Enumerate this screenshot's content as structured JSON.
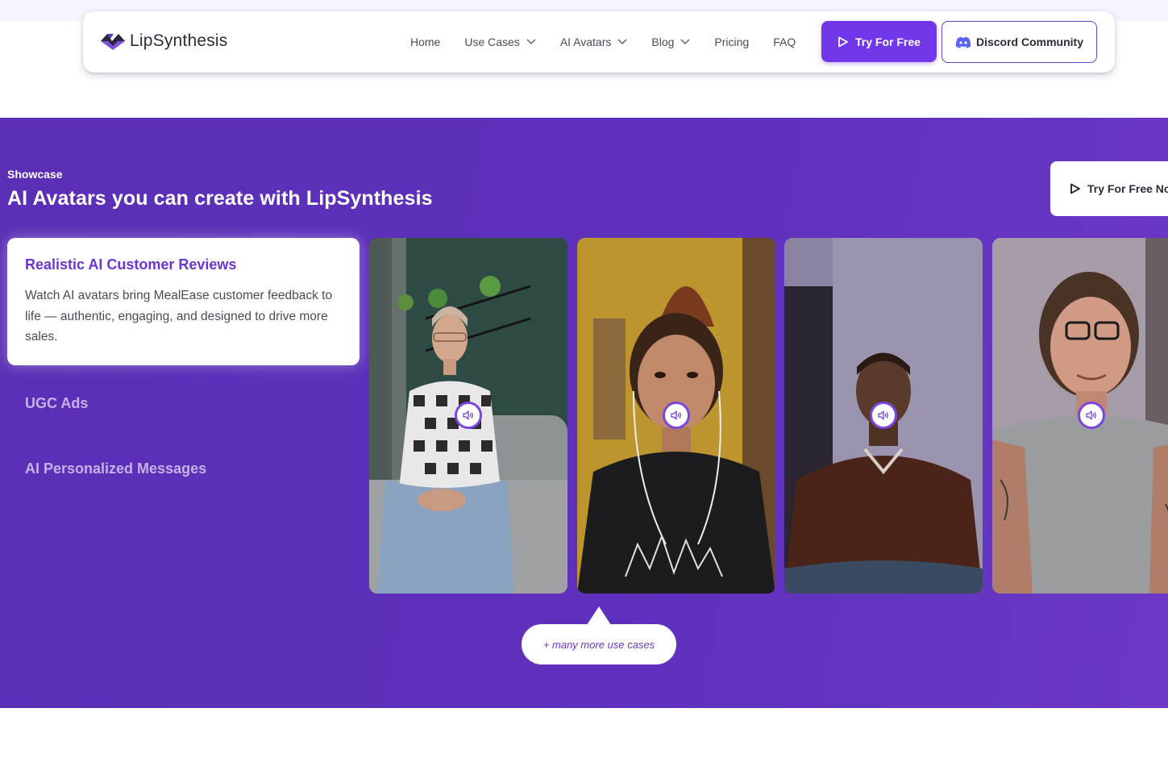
{
  "brand": {
    "name": "LipSynthesis"
  },
  "nav": {
    "items": [
      {
        "label": "Home",
        "has_dropdown": false
      },
      {
        "label": "Use Cases",
        "has_dropdown": true
      },
      {
        "label": "AI Avatars",
        "has_dropdown": true
      },
      {
        "label": "Blog",
        "has_dropdown": true
      },
      {
        "label": "Pricing",
        "has_dropdown": false
      },
      {
        "label": "FAQ",
        "has_dropdown": false
      }
    ],
    "try_button": "Try For Free",
    "discord_button": "Discord Community"
  },
  "showcase": {
    "eyebrow": "Showcase",
    "heading": "AI Avatars you can create with LipSynthesis",
    "cta": "Try For Free Now",
    "active_case": {
      "title": "Realistic AI Customer Reviews",
      "description": "Watch AI avatars bring MealEase customer feedback to life — authentic, engaging, and designed to drive more sales."
    },
    "other_cases": [
      "UGC Ads",
      "AI Personalized Messages"
    ],
    "videos": [
      {
        "subject": "woman-plaid-shirt-on-couch"
      },
      {
        "subject": "young-woman-with-earphones"
      },
      {
        "subject": "man-brown-sweater"
      },
      {
        "subject": "woman-glasses-grey-tshirt"
      }
    ],
    "more_label": "+ many more use cases"
  },
  "colors": {
    "accent": "#7038e8",
    "section_bg": "#5f30bd",
    "active_title": "#6a35d0",
    "inactive_case": "#c4b2ea"
  }
}
